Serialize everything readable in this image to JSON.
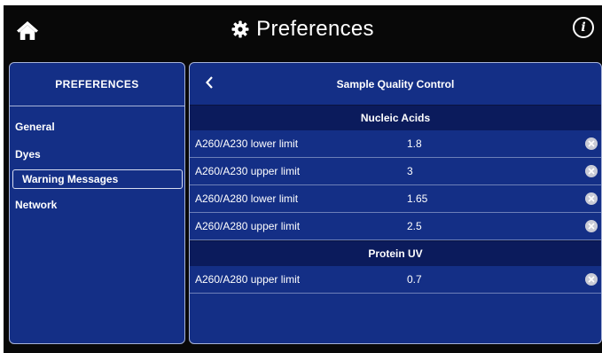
{
  "header": {
    "title": "Preferences",
    "icons": {
      "home": "home-icon",
      "title": "gear-icon",
      "info": "info-icon"
    },
    "info_glyph": "i"
  },
  "left_panel": {
    "title": "PREFERENCES",
    "items": [
      {
        "label": "General",
        "selected": false
      },
      {
        "label": "Dyes",
        "selected": false
      },
      {
        "label": "Warning Messages",
        "selected": true
      },
      {
        "label": "Network",
        "selected": false
      }
    ]
  },
  "right_panel": {
    "title": "Sample Quality Control",
    "back_icon": "chevron-left-icon",
    "sections": [
      {
        "title": "Nucleic Acids",
        "rows": [
          {
            "label": "A260/A230 lower limit",
            "value": "1.8"
          },
          {
            "label": "A260/A230 upper limit",
            "value": "3"
          },
          {
            "label": "A260/A280 lower limit",
            "value": "1.65"
          },
          {
            "label": "A260/A280 upper limit",
            "value": "2.5"
          }
        ]
      },
      {
        "title": "Protein UV",
        "rows": [
          {
            "label": "A260/A280 upper limit",
            "value": "0.7"
          }
        ]
      }
    ],
    "clear_icon": "clear-icon"
  },
  "colors": {
    "background": "#080808",
    "panel": "#142f86",
    "section_header": "#0b1b5c",
    "border": "#a7b3d8",
    "clear_button": "#c9cbd6"
  }
}
